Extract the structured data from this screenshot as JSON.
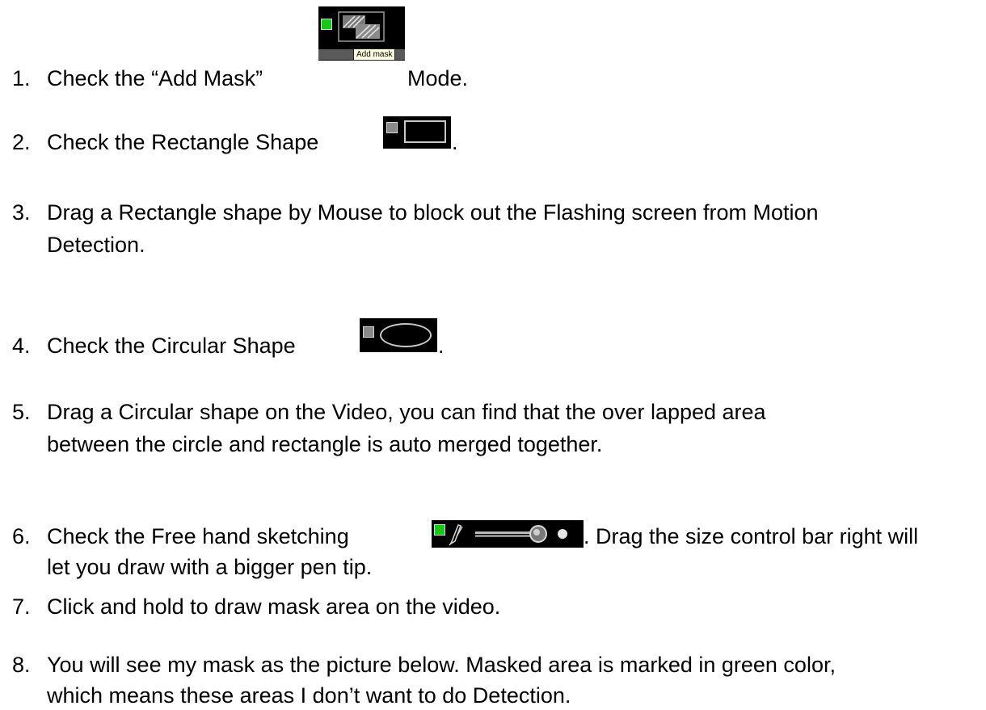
{
  "steps": [
    {
      "num": "1.",
      "lines": [
        "Check the “Add Mask” ",
        " Mode."
      ]
    },
    {
      "num": "2.",
      "lines": [
        "Check the Rectangle Shape ",
        "."
      ]
    },
    {
      "num": "3.",
      "lines": [
        "Drag a Rectangle shape by Mouse to block out the Flashing screen from Motion",
        "Detection."
      ]
    },
    {
      "num": "4.",
      "lines": [
        "Check the Circular Shape ",
        "."
      ]
    },
    {
      "num": "5.",
      "lines": [
        "Drag a Circular shape on the Video, you can find that the over lapped area",
        "between the circle and rectangle is auto merged together."
      ]
    },
    {
      "num": "6.",
      "lines": [
        "Check the Free hand sketching",
        ". Drag the size control bar right will",
        "let you draw with a bigger pen tip."
      ]
    },
    {
      "num": "7.",
      "lines": [
        "Click and hold to draw mask area on the video."
      ]
    },
    {
      "num": "8.",
      "lines": [
        "You will see my mask as the picture below. Masked area is marked in green color,",
        "which means these areas I don’t want to do Detection."
      ]
    }
  ],
  "icons": {
    "add_mask": {
      "icon": "add-mask-hatch-icon",
      "tooltip": "Add mask"
    },
    "rectangle": {
      "icon": "rectangle-shape-icon"
    },
    "circular": {
      "icon": "circular-shape-icon"
    },
    "freehand": {
      "icon": "pen-icon",
      "slider": "pen-size-slider"
    }
  },
  "colors": {
    "checkbox_green": "#18c818",
    "checkbox_grey": "#8a8a8a",
    "tooltip_bg": "#ffffe1"
  }
}
